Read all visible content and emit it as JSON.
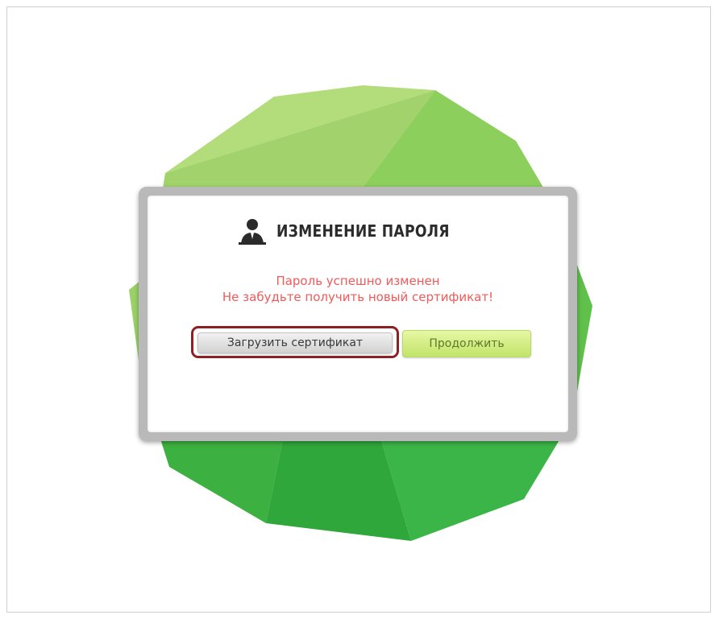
{
  "dialog": {
    "title": "ИЗМЕНЕНИЕ ПАРОЛЯ",
    "message_line1": "Пароль успешно изменен",
    "message_line2": "Не забудьте получить новый сертификат!",
    "buttons": {
      "load_certificate": "Загрузить сертификат",
      "continue": "Продолжить"
    }
  },
  "icons": {
    "title_icon": "user-icon"
  },
  "colors": {
    "message": "#f05a5a",
    "highlight_outline": "#8d1f24",
    "continue_button": "#c1e468",
    "gem_light": "#b6df7a",
    "gem_dark": "#2aa83a"
  }
}
